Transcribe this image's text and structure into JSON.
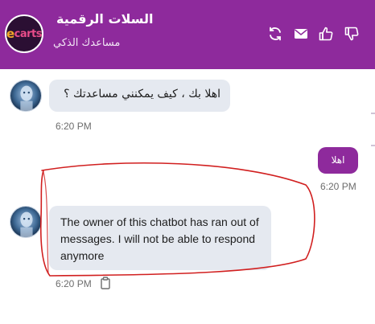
{
  "header": {
    "title": "السلات الرقمية",
    "subtitle": "مساعدك الذكي",
    "logo": {
      "e": "e",
      "rest": "carts"
    },
    "icons": [
      "refresh-icon",
      "email-icon",
      "thumbs-up-icon",
      "thumbs-down-icon"
    ],
    "color": "#8e2a9c"
  },
  "messages": [
    {
      "from": "bot",
      "text": "اهلا بك ، كيف يمكنني مساعدتك ؟",
      "time": "6:20 PM"
    },
    {
      "from": "user",
      "text": "اهلا",
      "time": "6:20 PM"
    },
    {
      "from": "bot",
      "text": "The owner of this chatbot has ran out of messages. I will not be able to respond anymore",
      "time": "6:20 PM",
      "icon": "copy-icon"
    }
  ],
  "annotation": {
    "color": "#d11f1f",
    "shape": "hand-drawn ellipse around last bot message"
  }
}
